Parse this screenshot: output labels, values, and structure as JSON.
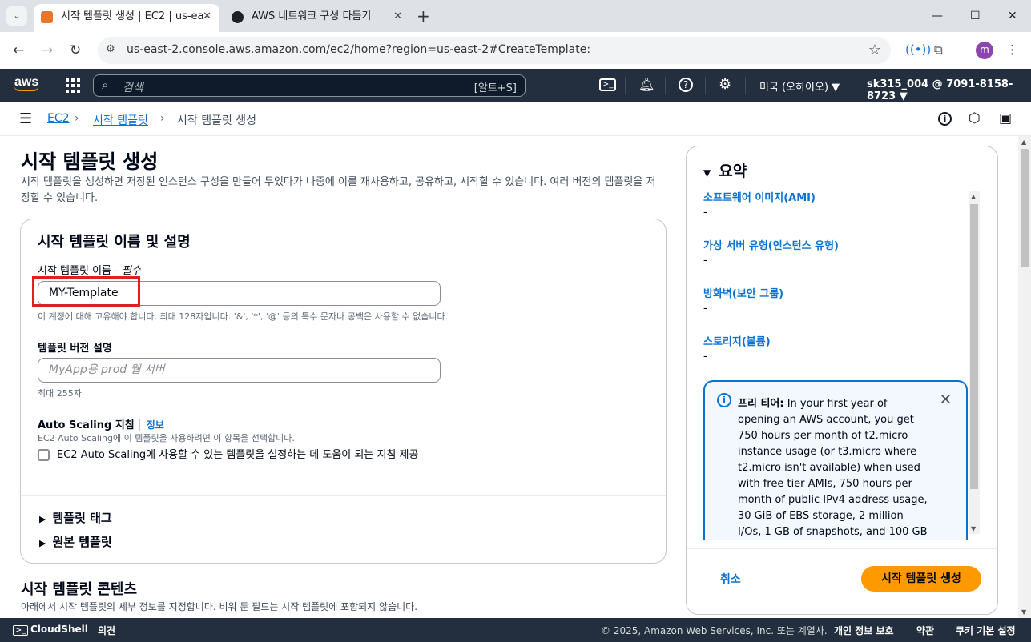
{
  "browser": {
    "tabs": [
      {
        "title": "시작 템플릿 생성 | EC2 | us-ea",
        "active": true
      },
      {
        "title": "AWS 네트워크 구성 다듬기",
        "active": false
      }
    ],
    "url": "us-east-2.console.aws.amazon.com/ec2/home?region=us-east-2#CreateTemplate:",
    "profile_initial": "m"
  },
  "aws_nav": {
    "logo": "aws",
    "search_placeholder": "검색",
    "search_shortcut": "[알트+S]",
    "region": "미국 (오하이오) ▼",
    "account": "sk315_004 @ 7091-8158-8723 ▼"
  },
  "breadcrumb": {
    "items": [
      "EC2",
      "시작 템플릿",
      "시작 템플릿 생성"
    ]
  },
  "page": {
    "title": "시작 템플릿 생성",
    "description": "시작 템플릿을 생성하면 저장된 인스턴스 구성을 만들어 두었다가 나중에 이를 재사용하고, 공유하고, 시작할 수 있습니다. 여러 버전의 템플릿을 저장할 수 있습니다."
  },
  "name_panel": {
    "title": "시작 템플릿 이름 및 설명",
    "name_label": "시작 템플릿 이름 - ",
    "name_required": "필수",
    "name_value": "MY-Template",
    "name_hint": "이 계정에 대해 고유해야 합니다. 최대 128자입니다. '&', '*', '@' 등의 특수 문자나 공백은 사용할 수 없습니다.",
    "version_label": "템플릿 버전 설명",
    "version_placeholder": "MyApp용 prod 웹 서버",
    "version_hint": "최대 255자",
    "asg_label": "Auto Scaling 지침",
    "asg_info": "정보",
    "asg_hint": "EC2 Auto Scaling에 이 템플릿을 사용하려면 이 항목을 선택합니다.",
    "asg_checkbox": "EC2 Auto Scaling에 사용할 수 있는 템플릿을 설정하는 데 도움이 되는 지침 제공",
    "expander_tags": "템플릿 태그",
    "expander_source": "원본 템플릿"
  },
  "content_section": {
    "title": "시작 템플릿 콘텐츠",
    "description": "아래에서 시작 템플릿의 세부 정보를 지정합니다. 비워 둔 필드는 시작 템플릿에 포함되지 않습니다."
  },
  "summary": {
    "title": "요약",
    "items": [
      {
        "title": "소프트웨어 이미지(AMI)",
        "value": "-"
      },
      {
        "title": "가상 서버 유형(인스턴스 유형)",
        "value": "-"
      },
      {
        "title": "방화벽(보안 그룹)",
        "value": "-"
      },
      {
        "title": "스토리지(볼륨)",
        "value": "-"
      }
    ],
    "free_tier_title": "프리 티어:",
    "free_tier_text": "In your first year of opening an AWS account, you get 750 hours per month of t2.micro instance usage (or t3.micro where t2.micro isn't available) when used with free tier AMIs, 750 hours per month of public IPv4 address usage, 30 GiB of EBS storage, 2 million I/Os, 1 GB of snapshots, and 100 GB",
    "cancel": "취소",
    "create": "시작 템플릿 생성"
  },
  "footer": {
    "cloudshell": "CloudShell",
    "feedback": "의견",
    "copyright": "© 2025, Amazon Web Services, Inc. 또는 계열사.",
    "privacy": "개인 정보 보호",
    "terms": "약관",
    "cookies": "쿠키 기본 설정"
  },
  "colors": {
    "aws_nav": "#232f3e",
    "link": "#0972d3",
    "primary_button": "#ff9900",
    "highlight_box": "#e02020"
  }
}
